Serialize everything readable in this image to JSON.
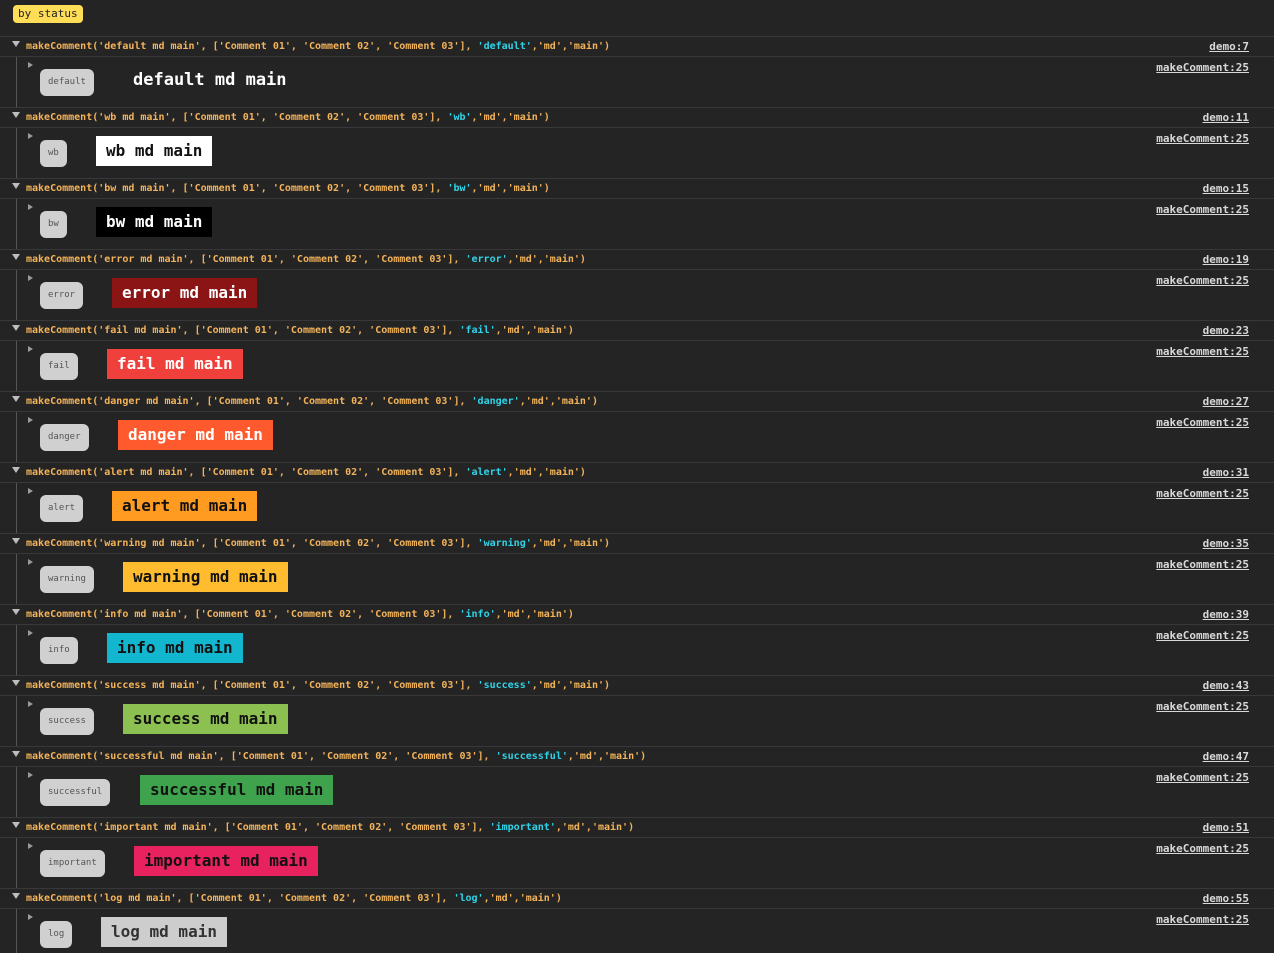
{
  "title": "by status",
  "link_source": "makeComment:25",
  "groups": [
    {
      "status": "default",
      "label": "default md main",
      "code": "makeComment('default md main', ['Comment 01', 'Comment 02', 'Comment 03'], ",
      "status_code": "'default'",
      "code_tail": ",'md','main')",
      "link": "demo:7",
      "bg": "transparent",
      "fg": "#ffffff"
    },
    {
      "status": "wb",
      "label": "wb md main",
      "code": "makeComment('wb md main', ['Comment 01', 'Comment 02', 'Comment 03'], ",
      "status_code": "'wb'",
      "code_tail": ",'md','main')",
      "link": "demo:11",
      "bg": "#ffffff",
      "fg": "#111111"
    },
    {
      "status": "bw",
      "label": "bw md main",
      "code": "makeComment('bw md main', ['Comment 01', 'Comment 02', 'Comment 03'], ",
      "status_code": "'bw'",
      "code_tail": ",'md','main')",
      "link": "demo:15",
      "bg": "#000000",
      "fg": "#ffffff"
    },
    {
      "status": "error",
      "label": "error md main",
      "code": "makeComment('error md main', ['Comment 01', 'Comment 02', 'Comment 03'], ",
      "status_code": "'error'",
      "code_tail": ",'md','main')",
      "link": "demo:19",
      "bg": "#8b1515",
      "fg": "#ffffff"
    },
    {
      "status": "fail",
      "label": "fail md main",
      "code": "makeComment('fail md main', ['Comment 01', 'Comment 02', 'Comment 03'], ",
      "status_code": "'fail'",
      "code_tail": ",'md','main')",
      "link": "demo:23",
      "bg": "#f0403c",
      "fg": "#ffffff"
    },
    {
      "status": "danger",
      "label": "danger md main",
      "code": "makeComment('danger md main', ['Comment 01', 'Comment 02', 'Comment 03'], ",
      "status_code": "'danger'",
      "code_tail": ",'md','main')",
      "link": "demo:27",
      "bg": "#ff5a2d",
      "fg": "#ffffff"
    },
    {
      "status": "alert",
      "label": "alert md main",
      "code": "makeComment('alert md main', ['Comment 01', 'Comment 02', 'Comment 03'], ",
      "status_code": "'alert'",
      "code_tail": ",'md','main')",
      "link": "demo:31",
      "bg": "#ff9b21",
      "fg": "#111111"
    },
    {
      "status": "warning",
      "label": "warning md main",
      "code": "makeComment('warning md main', ['Comment 01', 'Comment 02', 'Comment 03'], ",
      "status_code": "'warning'",
      "code_tail": ",'md','main')",
      "link": "demo:35",
      "bg": "#ffbc2e",
      "fg": "#111111"
    },
    {
      "status": "info",
      "label": "info md main",
      "code": "makeComment('info md main', ['Comment 01', 'Comment 02', 'Comment 03'], ",
      "status_code": "'info'",
      "code_tail": ",'md','main')",
      "link": "demo:39",
      "bg": "#12b6cf",
      "fg": "#111111"
    },
    {
      "status": "success",
      "label": "success md main",
      "code": "makeComment('success md main', ['Comment 01', 'Comment 02', 'Comment 03'], ",
      "status_code": "'success'",
      "code_tail": ",'md','main')",
      "link": "demo:43",
      "bg": "#8cc152",
      "fg": "#111111"
    },
    {
      "status": "successful",
      "label": "successful md main",
      "code": "makeComment('successful md main', ['Comment 01', 'Comment 02', 'Comment 03'], ",
      "status_code": "'successful'",
      "code_tail": ",'md','main')",
      "link": "demo:47",
      "bg": "#3fa34d",
      "fg": "#111111"
    },
    {
      "status": "important",
      "label": "important md main",
      "code": "makeComment('important md main', ['Comment 01', 'Comment 02', 'Comment 03'], ",
      "status_code": "'important'",
      "code_tail": ",'md','main')",
      "link": "demo:51",
      "bg": "#e8215f",
      "fg": "#111111"
    },
    {
      "status": "log",
      "label": "log md main",
      "code": "makeComment('log md main', ['Comment 01', 'Comment 02', 'Comment 03'], ",
      "status_code": "'log'",
      "code_tail": ",'md','main')",
      "link": "demo:55",
      "bg": "#cdcdcd",
      "fg": "#333333"
    }
  ]
}
